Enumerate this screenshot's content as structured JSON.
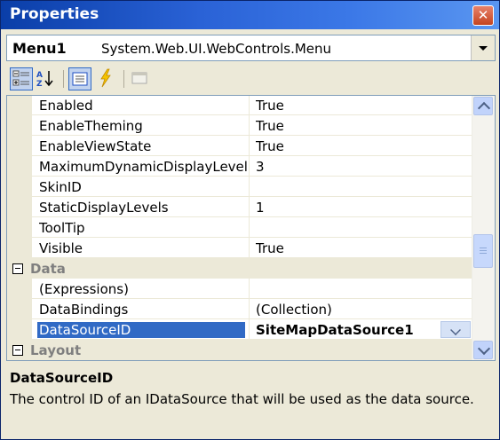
{
  "window": {
    "title": "Properties",
    "close_glyph": "✕"
  },
  "object_selector": {
    "name": "Menu1",
    "type": "System.Web.UI.WebControls.Menu"
  },
  "toolbar": {
    "buttons": [
      {
        "name": "categorized",
        "icon": "categorized-icon",
        "pressed": true
      },
      {
        "name": "alphabetical",
        "icon": "alphabetical-sort-icon",
        "pressed": false
      },
      {
        "name": "properties",
        "icon": "properties-icon",
        "pressed": true
      },
      {
        "name": "events",
        "icon": "lightning-events-icon",
        "pressed": false
      },
      {
        "name": "property-pages",
        "icon": "property-pages-icon",
        "pressed": false,
        "disabled": true
      }
    ]
  },
  "grid": {
    "rows": [
      {
        "kind": "prop",
        "name": "Enabled",
        "value": "True"
      },
      {
        "kind": "prop",
        "name": "EnableTheming",
        "value": "True"
      },
      {
        "kind": "prop",
        "name": "EnableViewState",
        "value": "True"
      },
      {
        "kind": "prop",
        "name": "MaximumDynamicDisplayLevels",
        "value": "3"
      },
      {
        "kind": "prop",
        "name": "SkinID",
        "value": ""
      },
      {
        "kind": "prop",
        "name": "StaticDisplayLevels",
        "value": "1"
      },
      {
        "kind": "prop",
        "name": "ToolTip",
        "value": ""
      },
      {
        "kind": "prop",
        "name": "Visible",
        "value": "True"
      },
      {
        "kind": "category",
        "name": "Data"
      },
      {
        "kind": "prop",
        "name": "(Expressions)",
        "value": ""
      },
      {
        "kind": "prop",
        "name": "DataBindings",
        "value": "(Collection)"
      },
      {
        "kind": "prop",
        "name": "DataSourceID",
        "value": "SiteMapDataSource1",
        "selected": true
      },
      {
        "kind": "category",
        "name": "Layout"
      }
    ]
  },
  "description": {
    "title": "DataSourceID",
    "text": "The control ID of an IDataSource that will be used as the data source."
  },
  "colors": {
    "title_bar": "#2a62d6",
    "selection": "#316ac5",
    "chrome": "#ece9d8",
    "category_text": "#7f7f7f"
  }
}
